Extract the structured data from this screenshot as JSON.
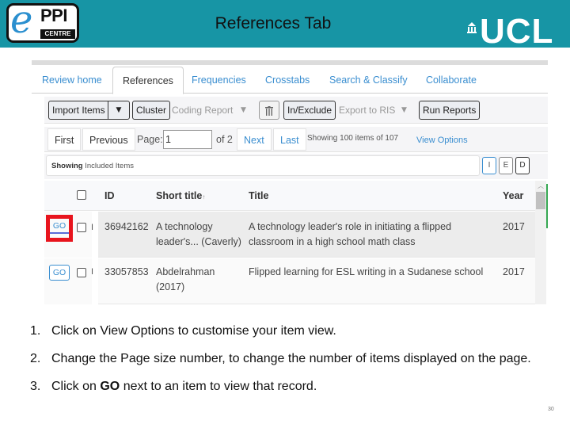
{
  "header": {
    "logo_left": {
      "letter": "e",
      "word": "PPI",
      "sub": "CENTRE"
    },
    "title": "References Tab",
    "logo_right": "UCL",
    "brand_color": "#1795a5"
  },
  "app": {
    "tabs": [
      {
        "label": "Review home",
        "active": false
      },
      {
        "label": "References",
        "active": true
      },
      {
        "label": "Frequencies",
        "active": false
      },
      {
        "label": "Crosstabs",
        "active": false
      },
      {
        "label": "Search & Classify",
        "active": false
      },
      {
        "label": "Collaborate",
        "active": false
      }
    ],
    "toolbar": {
      "import_items": "Import Items",
      "cluster": "Cluster",
      "coding_report": "Coding Report",
      "delete_icon": "trash-icon",
      "in_exclude": "In/Exclude",
      "export_ris": "Export to RIS",
      "run_reports": "Run Reports",
      "caret": "▼"
    },
    "pager": {
      "first": "First",
      "previous": "Previous",
      "page_label": "Page:",
      "page_value": "1",
      "of_label": "of 2",
      "next": "Next",
      "last": "Last",
      "showing_count": "Showing 100 items of 107",
      "view_options": "View Options"
    },
    "filter": {
      "showing_bold": "Showing",
      "showing_rest": " Included Items",
      "buttons": [
        "I",
        "E",
        "D"
      ]
    },
    "grid": {
      "columns": [
        "ID",
        "Short title",
        "Title",
        "Year"
      ],
      "sort_indicator": "↑",
      "rows": [
        {
          "go": "GO",
          "flag": "I",
          "id": "36942162",
          "short_title_1": "A technology",
          "short_title_2": "leader's... (Caverly)",
          "title_1": "A technology leader's role in initiating a flipped",
          "title_2": "classroom in a high school math class",
          "year": "2017",
          "highlighted": true
        },
        {
          "go": "GO",
          "flag": "I",
          "id": "33057853",
          "short_title_1": "Abdelrahman",
          "short_title_2": "(2017)",
          "title_1": "Flipped learning for ESL writing in a Sudanese school",
          "title_2": "",
          "year": "2017",
          "highlighted": false
        }
      ]
    }
  },
  "instructions": [
    {
      "num": "1.",
      "pre": "Click on View Options to customise your item view.",
      "bold": "",
      "post": ""
    },
    {
      "num": "2.",
      "pre": "Change the Page size number, to change the number of items displayed on the page.",
      "bold": "",
      "post": ""
    },
    {
      "num": "3.",
      "pre": "Click on ",
      "bold": "GO",
      "post": " next to an item to view that record."
    }
  ],
  "slide_number": "30"
}
